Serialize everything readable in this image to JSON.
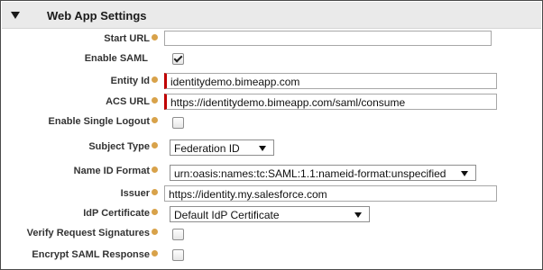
{
  "section": {
    "title": "Web App Settings"
  },
  "fields": {
    "start_url": {
      "label": "Start URL",
      "value": ""
    },
    "enable_saml": {
      "label": "Enable SAML",
      "checked": true
    },
    "entity_id": {
      "label": "Entity Id",
      "value": "identitydemo.bimeapp.com"
    },
    "acs_url": {
      "label": "ACS URL",
      "value": "https://identitydemo.bimeapp.com/saml/consume"
    },
    "enable_single_logout": {
      "label": "Enable Single Logout",
      "checked": false
    },
    "subject_type": {
      "label": "Subject Type",
      "value": "Federation ID"
    },
    "name_id_format": {
      "label": "Name ID Format",
      "value": "urn:oasis:names:tc:SAML:1.1:nameid-format:unspecified"
    },
    "issuer": {
      "label": "Issuer",
      "value": "https://identity.my.salesforce.com"
    },
    "idp_certificate": {
      "label": "IdP Certificate",
      "value": "Default IdP Certificate"
    },
    "verify_request_signatures": {
      "label": "Verify Request Signatures",
      "checked": false
    },
    "encrypt_saml_response": {
      "label": "Encrypt SAML Response",
      "checked": false
    }
  },
  "colors": {
    "header_bg": "#eaeaea",
    "required_marker": "#c00000",
    "help_icon": "#d8a24a"
  },
  "icons": {
    "section_toggle": "triangle-down-icon",
    "help": "help-icon",
    "select_caret": "caret-down-icon"
  }
}
